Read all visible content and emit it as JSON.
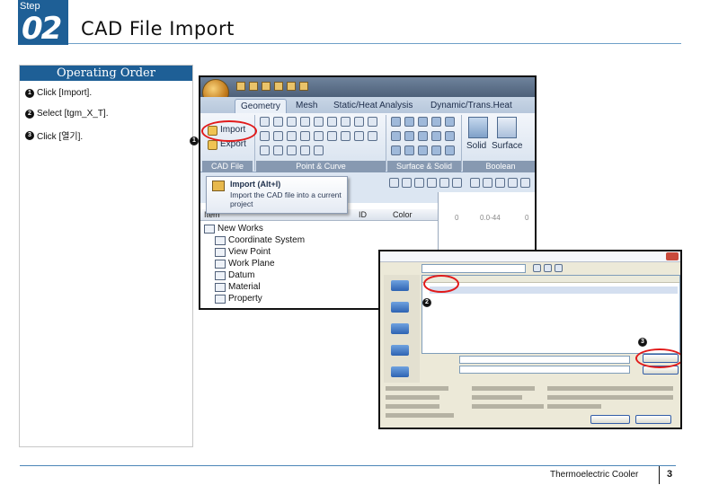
{
  "header": {
    "step_word": "Step",
    "step_number": "02",
    "title": "CAD File Import"
  },
  "panel": {
    "heading": "Operating Order",
    "items": [
      {
        "num": "1",
        "text": "Click [Import]."
      },
      {
        "num": "2",
        "text": "Select [tgm_X_T]."
      },
      {
        "num": "3",
        "text": "Click [열기]."
      }
    ]
  },
  "ribbon": {
    "tabs": [
      "Geometry",
      "Mesh",
      "Static/Heat Analysis",
      "Dynamic/Trans.Heat Analysis"
    ],
    "groups": [
      "CAD File",
      "Point & Curve",
      "Surface & Solid",
      "Boolean"
    ],
    "import_label": "Import",
    "export_label": "Export",
    "solid_label": "Solid",
    "surface_label": "Surface"
  },
  "tooltip": {
    "title": "Import (Alt+I)",
    "description": "Import the CAD file into a current project"
  },
  "tree": {
    "columns": [
      "Item",
      "ID",
      "Color"
    ],
    "rows": [
      "New Works",
      "Coordinate System",
      "View Point",
      "Work Plane",
      "Datum",
      "Material",
      "Property"
    ]
  },
  "viewport": {
    "label_a": "0",
    "label_b": "0.0-44",
    "label_c": "0"
  },
  "markers": {
    "m1": "1",
    "m2": "2",
    "m3": "3"
  },
  "footer": {
    "text": "Thermoelectric Cooler",
    "page": "3"
  }
}
